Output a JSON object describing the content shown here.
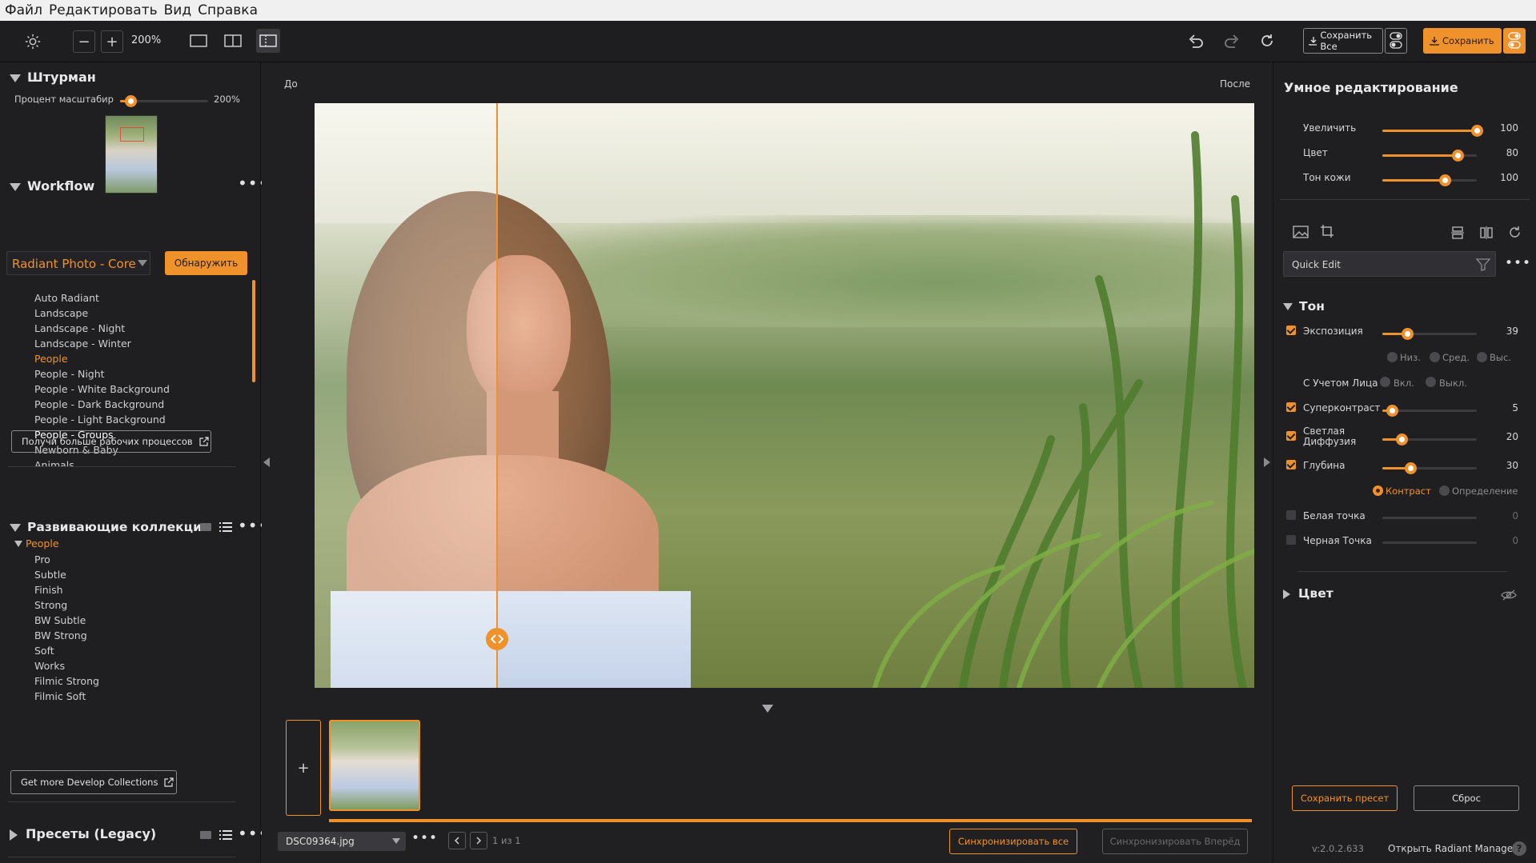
{
  "menu": [
    "Файл",
    "Редактировать",
    "Вид",
    "Справка"
  ],
  "toolbar": {
    "zoom": "200%",
    "save_all_label": "Сохранить Все",
    "save_label": "Сохранить"
  },
  "navigator": {
    "title": "Штурман",
    "zoom_label": "Процент масштабир",
    "zoom_value": "200%",
    "zoom_fraction": 0.12
  },
  "workflow": {
    "title": "Workflow",
    "selected": "Radiant Photo - Core",
    "detect_label": "Обнаружить",
    "items": [
      {
        "label": "Auto Radiant",
        "state": ""
      },
      {
        "label": "Landscape",
        "state": ""
      },
      {
        "label": "Landscape - Night",
        "state": ""
      },
      {
        "label": "Landscape - Winter",
        "state": ""
      },
      {
        "label": "People",
        "state": "active"
      },
      {
        "label": "People - Night",
        "state": ""
      },
      {
        "label": "People - White Background",
        "state": ""
      },
      {
        "label": "People - Dark Background",
        "state": ""
      },
      {
        "label": "People - Light Background",
        "state": ""
      },
      {
        "label": "People - Groups",
        "state": "bold"
      },
      {
        "label": "Newborn & Baby",
        "state": ""
      },
      {
        "label": "Animals",
        "state": ""
      }
    ],
    "more_label": "Получи больше рабочих процессов"
  },
  "collections": {
    "title": "Развивающие коллекции",
    "group": "People",
    "items": [
      "Pro",
      "Subtle",
      "Finish",
      "Strong",
      "BW Subtle",
      "BW Strong",
      "Soft",
      "Works",
      "Filmic Strong",
      "Filmic Soft"
    ],
    "more_label": "Get more Develop Collections"
  },
  "presets": {
    "title": "Пресеты (Legacy)"
  },
  "viewer": {
    "before_label": "До",
    "after_label": "После",
    "split_fraction": 0.193
  },
  "filmstrip": {
    "add_label": "+",
    "filename": "DSC09364.jpg",
    "page_info": "1 из 1",
    "sync_all_label": "Синхронизировать все",
    "sync_forward_label": "Синхронизировать Вперёд"
  },
  "smart": {
    "title": "Умное редактирование",
    "sliders": [
      {
        "label": "Увеличить",
        "value": "100",
        "fraction": 1.0
      },
      {
        "label": "Цвет",
        "value": "80",
        "fraction": 0.8
      },
      {
        "label": "Тон кожи",
        "value": "100",
        "fraction": 0.66
      }
    ],
    "preset_name": "Quick Edit"
  },
  "tone": {
    "title": "Тон",
    "exposure": {
      "label": "Экспозиция",
      "value": "39",
      "fraction": 0.26
    },
    "range_options": [
      "Низ.",
      "Сред.",
      "Выс."
    ],
    "face_label": "С Учетом Лица",
    "face_options": [
      "Вкл.",
      "Выкл."
    ],
    "supercontrast": {
      "label": "Суперконтраст",
      "value": "5",
      "fraction": 0.1
    },
    "diffusion": {
      "label": "Светлая Диффузия",
      "value": "20",
      "fraction": 0.2
    },
    "depth": {
      "label": "Глубина",
      "value": "30",
      "fraction": 0.3
    },
    "depth_options": [
      "Контраст",
      "Определение"
    ],
    "white_point": {
      "label": "Белая точка",
      "value": "0"
    },
    "black_point": {
      "label": "Черная Точка",
      "value": "0"
    }
  },
  "color_section": {
    "title": "Цвет"
  },
  "footer": {
    "save_preset_label": "Сохранить пресет",
    "reset_label": "Сброс",
    "version": "v:2.0.2.633",
    "manager_link": "Открыть Radiant Manager",
    "help": "?"
  },
  "colors": {
    "accent": "#f0922b",
    "panel": "#1f1f22"
  }
}
